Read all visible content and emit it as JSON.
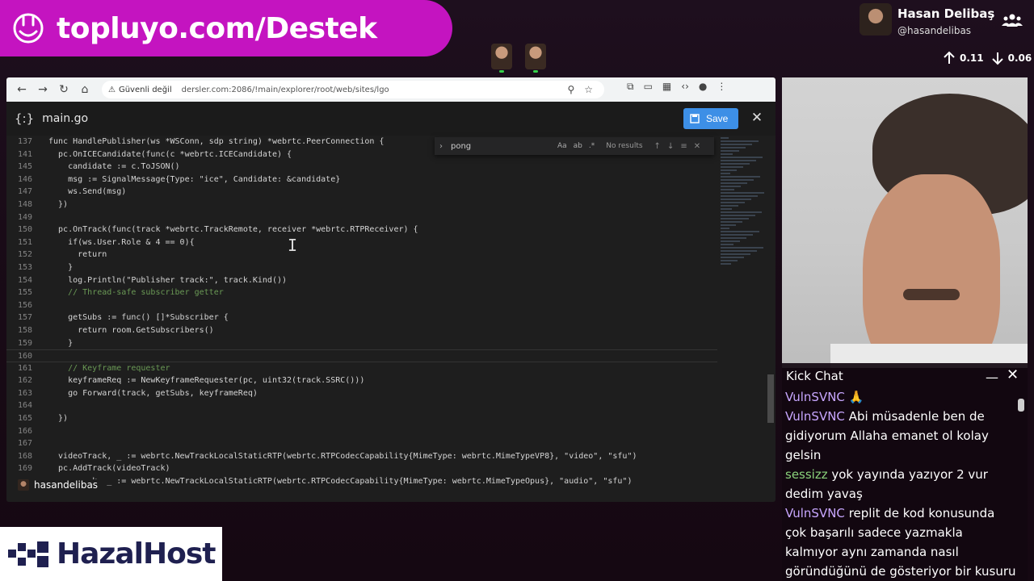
{
  "banner": {
    "text": "topluyo.com/Destek"
  },
  "profile": {
    "name": "Hasan Delibaş",
    "handle": "@hasandelibas"
  },
  "net": {
    "up": "0.11",
    "down": "0.06"
  },
  "browser": {
    "security_label": "Güvenli değil",
    "url": "dersler.com:2086/!main/explorer/root/web/sites/lgo"
  },
  "editor": {
    "filename": "main.go",
    "save_label": "Save",
    "find": {
      "query": "pong",
      "status": "No results"
    },
    "user": "hasandelibas"
  },
  "code_lines": [
    {
      "n": "137",
      "t": "func HandlePublisher(ws *WSConn, sdp string) *webrtc.PeerConnection {"
    },
    {
      "n": "141",
      "t": "  pc.OnICECandidate(func(c *webrtc.ICECandidate) {"
    },
    {
      "n": "145",
      "t": "    candidate := c.ToJSON()"
    },
    {
      "n": "146",
      "t": "    msg := SignalMessage{Type: \"ice\", Candidate: &candidate}"
    },
    {
      "n": "147",
      "t": "    ws.Send(msg)"
    },
    {
      "n": "148",
      "t": "  })"
    },
    {
      "n": "149",
      "t": ""
    },
    {
      "n": "150",
      "t": "  pc.OnTrack(func(track *webrtc.TrackRemote, receiver *webrtc.RTPReceiver) {"
    },
    {
      "n": "151",
      "t": "    if(ws.User.Role & 4 == 0){"
    },
    {
      "n": "152",
      "t": "      return"
    },
    {
      "n": "153",
      "t": "    }"
    },
    {
      "n": "154",
      "t": "    log.Println(\"Publisher track:\", track.Kind())"
    },
    {
      "n": "155",
      "t": "    // Thread-safe subscriber getter"
    },
    {
      "n": "156",
      "t": ""
    },
    {
      "n": "157",
      "t": "    getSubs := func() []*Subscriber {"
    },
    {
      "n": "158",
      "t": "      return room.GetSubscribers()"
    },
    {
      "n": "159",
      "t": "    }"
    },
    {
      "n": "160",
      "t": ""
    },
    {
      "n": "161",
      "t": "    // Keyframe requester"
    },
    {
      "n": "162",
      "t": "    keyframeReq := NewKeyframeRequester(pc, uint32(track.SSRC()))"
    },
    {
      "n": "163",
      "t": "    go Forward(track, getSubs, keyframeReq)"
    },
    {
      "n": "164",
      "t": ""
    },
    {
      "n": "165",
      "t": "  })"
    },
    {
      "n": "166",
      "t": ""
    },
    {
      "n": "167",
      "t": ""
    },
    {
      "n": "168",
      "t": "  videoTrack, _ := webrtc.NewTrackLocalStaticRTP(webrtc.RTPCodecCapability{MimeType: webrtc.MimeTypeVP8}, \"video\", \"sfu\")"
    },
    {
      "n": "169",
      "t": "  pc.AddTrack(videoTrack)"
    },
    {
      "n": "",
      "t": "         k, _ := webrtc.NewTrackLocalStaticRTP(webrtc.RTPCodecCapability{MimeType: webrtc.MimeTypeOpus}, \"audio\", \"sfu\")"
    }
  ],
  "chat": {
    "title": "Kick Chat",
    "messages": [
      {
        "user": "VulnSVNC",
        "text": "🙏"
      },
      {
        "user": "VulnSVNC",
        "text": "Abi müsadenle ben de gidiyorum Allaha emanet ol kolay gelsin"
      },
      {
        "user": "sessizz",
        "text": "yok yayında yazıyor 2 vur dedim yavaş"
      },
      {
        "user": "VulnSVNC",
        "text": "replit de kod konusunda çok başarılı sadece yazmakla kalmıyor aynı zamanda nasıl göründüğünü de gösteriyor bir kusuru var günlük"
      }
    ]
  },
  "logo": {
    "text": "HazalHost"
  }
}
